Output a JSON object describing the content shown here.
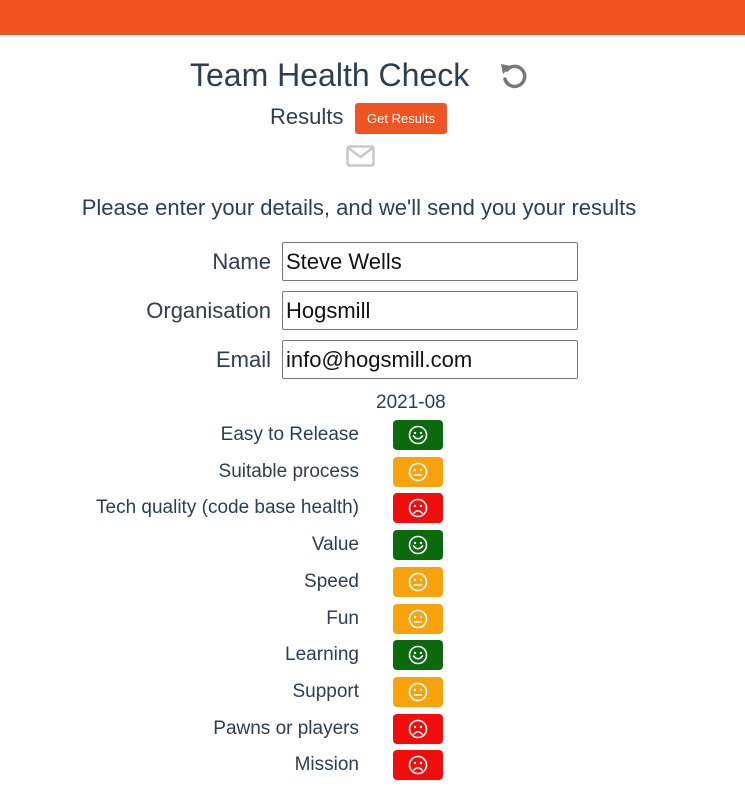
{
  "header": {
    "title": "Team Health Check",
    "reset_icon": "undo-icon",
    "bar_color": "#f05423"
  },
  "results": {
    "label": "Results",
    "button_label": "Get Results",
    "mail_icon": "envelope-icon"
  },
  "prompt": "Please enter your details, and we'll send you your results",
  "form": {
    "name": {
      "label": "Name",
      "value": "Steve Wells"
    },
    "organisation": {
      "label": "Organisation",
      "value": "Hogsmill"
    },
    "email": {
      "label": "Email",
      "value": "info@hogsmill.com"
    }
  },
  "period": "2021-08",
  "status_colors": {
    "good": "#0b6a0b",
    "ok": "#f8a30b",
    "bad": "#f20d0d"
  },
  "checks": [
    {
      "label": "Easy to Release",
      "status": "good",
      "icon": "happy-face-icon"
    },
    {
      "label": "Suitable process",
      "status": "ok",
      "icon": "neutral-face-icon"
    },
    {
      "label": "Tech quality (code base health)",
      "status": "bad",
      "icon": "sad-face-icon"
    },
    {
      "label": "Value",
      "status": "good",
      "icon": "happy-face-icon"
    },
    {
      "label": "Speed",
      "status": "ok",
      "icon": "neutral-face-icon"
    },
    {
      "label": "Fun",
      "status": "ok",
      "icon": "neutral-face-icon"
    },
    {
      "label": "Learning",
      "status": "good",
      "icon": "happy-face-icon"
    },
    {
      "label": "Support",
      "status": "ok",
      "icon": "neutral-face-icon"
    },
    {
      "label": "Pawns or players",
      "status": "bad",
      "icon": "sad-face-icon"
    },
    {
      "label": "Mission",
      "status": "bad",
      "icon": "sad-face-icon"
    }
  ]
}
